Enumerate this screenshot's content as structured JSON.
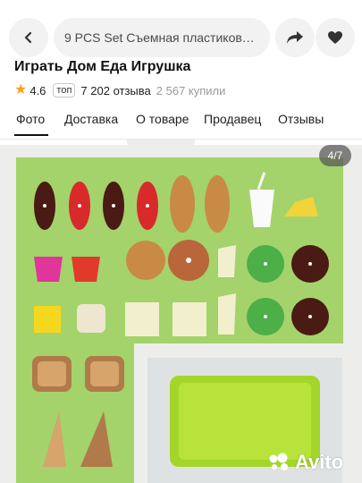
{
  "header": {
    "back_icon": "chevron-left-icon",
    "search_text": "9 PCS Set Съемная пластиковая…",
    "share_icon": "share-arrow-icon",
    "favorite_icon": "heart-icon"
  },
  "product": {
    "title": "Играть Дом Еда Игрушка",
    "rating": "4.6",
    "badge": "топ",
    "reviews": "7 202 отзыва",
    "bought": "2 567 купили"
  },
  "tabs": [
    {
      "label": "Фото"
    },
    {
      "label": "Доставка"
    },
    {
      "label": "О товаре"
    },
    {
      "label": "Продавец"
    },
    {
      "label": "Отзывы"
    }
  ],
  "gallery": {
    "counter": "4/7",
    "watermark": "Avito"
  },
  "colors": {
    "green_board": "#a3d36a",
    "tray": "#aadd44",
    "star": "#ff9f1a"
  }
}
